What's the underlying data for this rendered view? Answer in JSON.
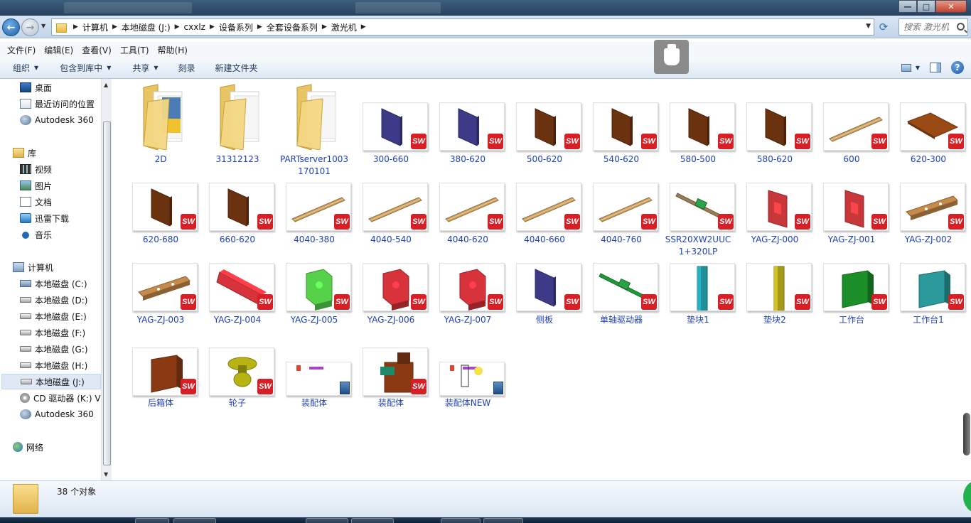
{
  "window": {
    "controls": {
      "minimize": "—",
      "maximize": "□",
      "close": "✕"
    }
  },
  "address": {
    "back_glyph": "←",
    "forward_glyph": "→",
    "crumbs": [
      "计算机",
      "本地磁盘 (J:)",
      "cxxlz",
      "设备系列",
      "全套设备系列",
      "激光机"
    ],
    "search_placeholder": "搜索 激光机"
  },
  "menu": [
    "文件(F)",
    "编辑(E)",
    "查看(V)",
    "工具(T)",
    "帮助(H)"
  ],
  "toolbar": {
    "organize": "组织",
    "include_library": "包含到库中",
    "share": "共享",
    "burn": "刻录",
    "new_folder": "新建文件夹",
    "help": "?"
  },
  "sidebar": {
    "favorites": [
      {
        "label": "桌面",
        "icon": "desktop-icon"
      },
      {
        "label": "最近访问的位置",
        "icon": "recent-places-icon"
      },
      {
        "label": "Autodesk 360",
        "icon": "autodesk-cloud-icon"
      }
    ],
    "libraries": {
      "label": "库",
      "items": [
        {
          "label": "视频",
          "icon": "video-icon"
        },
        {
          "label": "图片",
          "icon": "pictures-icon"
        },
        {
          "label": "文档",
          "icon": "documents-icon"
        },
        {
          "label": "迅雷下载",
          "icon": "download-icon"
        },
        {
          "label": "音乐",
          "icon": "music-icon"
        }
      ]
    },
    "computer": {
      "label": "计算机",
      "items": [
        {
          "label": "本地磁盘 (C:)",
          "icon": "system-drive-icon"
        },
        {
          "label": "本地磁盘 (D:)",
          "icon": "drive-icon"
        },
        {
          "label": "本地磁盘 (E:)",
          "icon": "drive-icon"
        },
        {
          "label": "本地磁盘 (F:)",
          "icon": "drive-icon"
        },
        {
          "label": "本地磁盘 (G:)",
          "icon": "drive-icon"
        },
        {
          "label": "本地磁盘 (H:)",
          "icon": "drive-icon"
        },
        {
          "label": "本地磁盘 (J:)",
          "icon": "drive-icon",
          "selected": true
        },
        {
          "label": "CD 驱动器 (K:) V",
          "icon": "cd-drive-icon"
        },
        {
          "label": "Autodesk 360",
          "icon": "autodesk-cloud-icon"
        }
      ]
    },
    "network": {
      "label": "网络",
      "icon": "network-icon"
    }
  },
  "badges": {
    "solidworks": "SW"
  },
  "colors": {
    "link_text": "#1c3fc0",
    "sw_red": "#d71f25",
    "accent_blue": "#1e395b"
  },
  "files": [
    {
      "name": "2D",
      "type": "folder"
    },
    {
      "name": "31312123",
      "type": "folder"
    },
    {
      "name": "PARTserver1003170101",
      "type": "folder"
    },
    {
      "name": "300-660",
      "type": "part",
      "shape": "panel",
      "color": "#3d3b88"
    },
    {
      "name": "380-620",
      "type": "part",
      "shape": "panel",
      "color": "#3d3b88"
    },
    {
      "name": "500-620",
      "type": "part",
      "shape": "panel",
      "color": "#6b3210"
    },
    {
      "name": "540-620",
      "type": "part",
      "shape": "panel",
      "color": "#6b3210"
    },
    {
      "name": "580-500",
      "type": "part",
      "shape": "panel",
      "color": "#6b3210"
    },
    {
      "name": "580-620",
      "type": "part",
      "shape": "panel",
      "color": "#6b3210"
    },
    {
      "name": "600",
      "type": "part",
      "shape": "rod",
      "color": "#c9a166"
    },
    {
      "name": "620-300",
      "type": "part",
      "shape": "plate",
      "color": "#9a4a14"
    },
    {
      "name": "620-680",
      "type": "part",
      "shape": "panel",
      "color": "#6b3210"
    },
    {
      "name": "660-620",
      "type": "part",
      "shape": "panel",
      "color": "#6b3210"
    },
    {
      "name": "4040-380",
      "type": "part",
      "shape": "rod",
      "color": "#c9a166"
    },
    {
      "name": "4040-540",
      "type": "part",
      "shape": "rod",
      "color": "#c9a166"
    },
    {
      "name": "4040-620",
      "type": "part",
      "shape": "rod",
      "color": "#c9a166"
    },
    {
      "name": "4040-660",
      "type": "part",
      "shape": "rod",
      "color": "#c9a166"
    },
    {
      "name": "4040-760",
      "type": "part",
      "shape": "rod",
      "color": "#c9a166"
    },
    {
      "name": "SSR20XW2UUC1+320LP",
      "type": "part",
      "shape": "rail",
      "color": "#9a7d55"
    },
    {
      "name": "YAG-ZJ-000",
      "type": "part",
      "shape": "bracket",
      "color": "#c8383a"
    },
    {
      "name": "YAG-ZJ-001",
      "type": "part",
      "shape": "bracket",
      "color": "#c8383a"
    },
    {
      "name": "YAG-ZJ-002",
      "type": "part",
      "shape": "bar",
      "color": "#c68a4a"
    },
    {
      "name": "YAG-ZJ-003",
      "type": "part",
      "shape": "bar",
      "color": "#c68a4a"
    },
    {
      "name": "YAG-ZJ-004",
      "type": "part",
      "shape": "slab",
      "color": "#d8323a"
    },
    {
      "name": "YAG-ZJ-005",
      "type": "part",
      "shape": "block",
      "color": "#55d24a"
    },
    {
      "name": "YAG-ZJ-006",
      "type": "part",
      "shape": "block",
      "color": "#d8323a"
    },
    {
      "name": "YAG-ZJ-007",
      "type": "part",
      "shape": "block",
      "color": "#d8323a"
    },
    {
      "name": "侧板",
      "type": "part",
      "shape": "panel",
      "color": "#3d3b88"
    },
    {
      "name": "单轴驱动器",
      "type": "part",
      "shape": "rail",
      "color": "#1f9a38"
    },
    {
      "name": "垫块1",
      "type": "part",
      "shape": "post",
      "color": "#1f8f9a"
    },
    {
      "name": "垫块2",
      "type": "part",
      "shape": "post",
      "color": "#a79a1a"
    },
    {
      "name": "工作台",
      "type": "part",
      "shape": "box",
      "color": "#1d8f2a"
    },
    {
      "name": "工作台1",
      "type": "part",
      "shape": "box",
      "color": "#2a9a9a"
    },
    {
      "name": "后箱体",
      "type": "part",
      "shape": "box",
      "color": "#8a3a12"
    },
    {
      "name": "轮子",
      "type": "part",
      "shape": "wheel",
      "color": "#b8b414"
    },
    {
      "name": "装配体",
      "type": "drawing"
    },
    {
      "name": "装配体",
      "type": "part",
      "shape": "assembly",
      "color": "#8a3a12"
    },
    {
      "name": "装配体NEW",
      "type": "drawing"
    }
  ],
  "status": {
    "count": "38 个对象"
  }
}
